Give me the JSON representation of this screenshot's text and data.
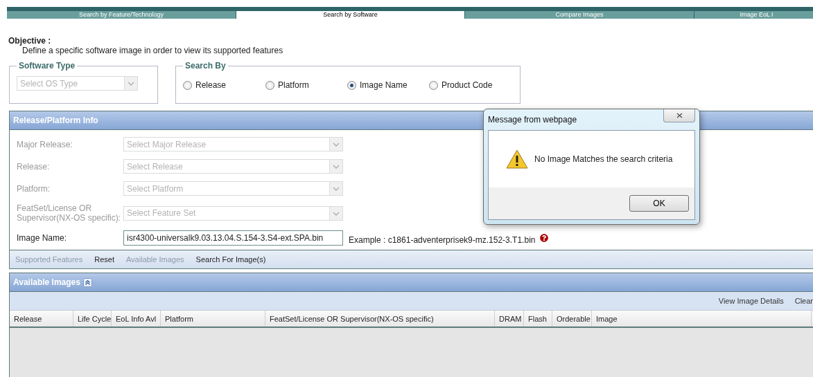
{
  "tabs": [
    {
      "label": "Search by Feature/Technology",
      "selected": false
    },
    {
      "label": "Search by Software",
      "selected": true
    },
    {
      "label": "Compare Images",
      "selected": false
    },
    {
      "label": "Image EoL I",
      "selected": false
    }
  ],
  "objective": {
    "title": "Objective :",
    "text": "Define a specific software image in order to view its supported features"
  },
  "software_type": {
    "legend": "Software Type",
    "placeholder": "Select OS Type",
    "disabled": true
  },
  "search_by": {
    "legend": "Search By",
    "options": [
      {
        "label": "Release",
        "selected": false
      },
      {
        "label": "Platform",
        "selected": false
      },
      {
        "label": "Image Name",
        "selected": true
      },
      {
        "label": "Product Code",
        "selected": false
      }
    ]
  },
  "release_panel": {
    "title": "Release/Platform Info",
    "fields": [
      {
        "kind": "select",
        "label": "Major Release:",
        "placeholder": "Select Major Release",
        "disabled": true
      },
      {
        "kind": "select",
        "label": "Release:",
        "placeholder": "Select Release",
        "disabled": true
      },
      {
        "kind": "select",
        "label": "Platform:",
        "placeholder": "Select Platform",
        "disabled": true
      },
      {
        "kind": "select",
        "label": "FeatSet/License OR Supervisor(NX-OS specific):",
        "placeholder": "Select Feature Set",
        "disabled": true
      },
      {
        "kind": "text",
        "label": "Image Name:",
        "value": "isr4300-universalk9.03.13.04.S.154-3.S4-ext.SPA.bin",
        "disabled": false
      }
    ],
    "example": "Example : c1861-adventerprisek9-mz.152-3.T1.bin",
    "actions": [
      {
        "label": "Supported Features",
        "disabled": true
      },
      {
        "label": "Reset",
        "disabled": false
      },
      {
        "label": "Available Images",
        "disabled": true
      },
      {
        "label": "Search For Image(s)",
        "disabled": false
      }
    ]
  },
  "images_panel": {
    "title": "Available Images",
    "toolbar": [
      "View Image Details",
      "Clear"
    ],
    "columns": [
      "Release",
      "Life Cycle",
      "EoL Info Avl",
      "Platform",
      "FeatSet/License OR Supervisor(NX-OS specific)",
      "DRAM",
      "Flash",
      "Orderable",
      "Image"
    ]
  },
  "dialog": {
    "title": "Message from webpage",
    "message": "No Image Matches the search criteria",
    "buttons": [
      "OK"
    ]
  }
}
